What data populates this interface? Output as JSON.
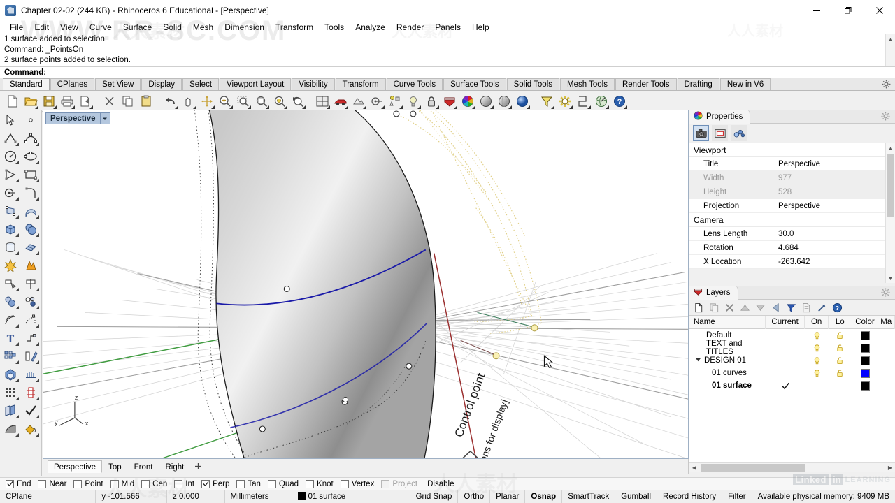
{
  "window": {
    "title": "Chapter 02-02 (244 KB) - Rhinoceros 6 Educational - [Perspective]",
    "icon": "rhino-app-icon",
    "controls": {
      "minimize": "minimize-icon",
      "restore": "restore-icon",
      "close": "close-icon"
    }
  },
  "menubar": {
    "items": [
      {
        "label": "File"
      },
      {
        "label": "Edit"
      },
      {
        "label": "View"
      },
      {
        "label": "Curve"
      },
      {
        "label": "Surface"
      },
      {
        "label": "Solid"
      },
      {
        "label": "Mesh"
      },
      {
        "label": "Dimension"
      },
      {
        "label": "Transform"
      },
      {
        "label": "Tools"
      },
      {
        "label": "Analyze"
      },
      {
        "label": "Render"
      },
      {
        "label": "Panels"
      },
      {
        "label": "Help"
      }
    ]
  },
  "command_history": {
    "lines": [
      "1 surface added to selection.",
      "Command: _PointsOn",
      "2 surface points added to selection."
    ],
    "prompt": "Command:"
  },
  "toolbar_tabs": {
    "active": "Standard",
    "items": [
      "Standard",
      "CPlanes",
      "Set View",
      "Display",
      "Select",
      "Viewport Layout",
      "Visibility",
      "Transform",
      "Curve Tools",
      "Surface Tools",
      "Solid Tools",
      "Mesh Tools",
      "Render Tools",
      "Drafting",
      "New in V6"
    ]
  },
  "main_toolbar": {
    "buttons": [
      "new-file-icon",
      "open-folder-icon",
      "save-icon",
      "print-icon",
      "export-icon",
      "cut-scissors-icon",
      "copy-icon",
      "paste-icon",
      "undo-icon",
      "pan-hand-icon",
      "rotate-view-icon",
      "zoom-in-icon",
      "zoom-window-icon",
      "zoom-extents-icon",
      "zoom-selected-icon",
      "zoom-previous-icon",
      "viewport-layout-icon",
      "four-view-icon",
      "render-car-icon",
      "render-preview-icon",
      "set-cplane-icon",
      "object-snap-icon",
      "light-bulb-icon",
      "lock-icon",
      "layers-icon",
      "color-wheel-icon",
      "shade-sphere-icon",
      "render-sphere-icon",
      "blue-sphere-icon",
      "selection-filter-icon",
      "options-gear-icon",
      "distance-icon",
      "analyze-globe-icon",
      "help-icon"
    ]
  },
  "left_toolbar": {
    "buttons": [
      "select-arrow-icon",
      "point-icon",
      "polyline-icon",
      "control-point-curve-icon",
      "circle-icon",
      "ellipse-icon",
      "polygon-icon",
      "rectangle-icon",
      "arc-icon",
      "curve-fillet-icon",
      "surface-edit-points-icon",
      "surface-from-curve-icon",
      "box-icon",
      "sphere-icon",
      "cylinder-icon",
      "surface-patch-icon",
      "explode-icon",
      "boolean-icon",
      "trim-icon",
      "split-icon",
      "fillet-icon",
      "chamfer-icon",
      "offset-curve-icon",
      "offset-surface-icon",
      "text-icon",
      "dimension-icon",
      "array-icon",
      "mirror-icon",
      "extrude-solid-icon",
      "loft-icon",
      "grid-array-icon",
      "rebuild-icon",
      "copy-object-icon",
      "check-icon",
      "shade-icon",
      "paint-bucket-icon"
    ]
  },
  "viewport": {
    "title": "Perspective",
    "dropdown_icon": "chevron-down-icon",
    "cplane_axes": {
      "x": "x",
      "y": "y",
      "z": "z"
    },
    "annotations": [
      {
        "text": "Control point"
      },
      {
        "text": "[options for display]"
      }
    ],
    "colors": {
      "grid_line": "#cfcfcf",
      "grid_major": "#9a9a9a",
      "x_axis": "#8f3030",
      "y_axis": "#2f7a2f",
      "surface_light": "#f2f2f2",
      "surface_dark": "#8e8e8e",
      "isocurve": "#1a1aaa",
      "control_polygon": "#e3cf8a",
      "control_point": "#f0e8a8"
    },
    "tabs": {
      "active": "Perspective",
      "items": [
        "Perspective",
        "Top",
        "Front",
        "Right"
      ],
      "add_label": "+"
    }
  },
  "properties_panel": {
    "title": "Properties",
    "icon": "properties-icon",
    "gear_icon": "gear-icon",
    "tool_icons": [
      {
        "name": "camera-icon",
        "selected": true
      },
      {
        "name": "viewport-frame-icon",
        "selected": false
      },
      {
        "name": "material-icon",
        "selected": false
      }
    ],
    "groups": [
      {
        "title": "Viewport",
        "rows": [
          {
            "key": "Title",
            "value": "Perspective",
            "dim": false,
            "dropdown": false
          },
          {
            "key": "Width",
            "value": "977",
            "dim": true,
            "dropdown": false
          },
          {
            "key": "Height",
            "value": "528",
            "dim": true,
            "dropdown": false
          },
          {
            "key": "Projection",
            "value": "Perspective",
            "dim": false,
            "dropdown": true
          }
        ]
      },
      {
        "title": "Camera",
        "rows": [
          {
            "key": "Lens Length",
            "value": "30.0",
            "dim": false,
            "dropdown": false
          },
          {
            "key": "Rotation",
            "value": "4.684",
            "dim": false,
            "dropdown": false
          },
          {
            "key": "X Location",
            "value": "-263.642",
            "dim": false,
            "dropdown": false
          }
        ]
      }
    ]
  },
  "layers_panel": {
    "title": "Layers",
    "icon": "layers-icon",
    "gear_icon": "gear-icon",
    "toolbar_icons": [
      "new-layer-icon",
      "copy-layer-icon",
      "delete-layer-icon",
      "move-up-icon",
      "move-down-icon",
      "move-left-icon",
      "filter-icon",
      "layer-properties-icon",
      "layer-tools-icon",
      "help-icon"
    ],
    "columns": [
      "Name",
      "Current",
      "On",
      "Lo",
      "Color",
      "Ma"
    ],
    "rows": [
      {
        "name": "Default",
        "indent": 1,
        "current": false,
        "on": true,
        "lock": "unlocked",
        "color": "#000000",
        "bold": false,
        "expander": ""
      },
      {
        "name": "TEXT and TITLES",
        "indent": 1,
        "current": false,
        "on": true,
        "lock": "unlocked",
        "color": "#000000",
        "bold": false,
        "expander": ""
      },
      {
        "name": "DESIGN 01",
        "indent": 0,
        "current": false,
        "on": true,
        "lock": "unlocked",
        "color": "#000000",
        "bold": false,
        "expander": "expanded"
      },
      {
        "name": "01 curves",
        "indent": 2,
        "current": false,
        "on": true,
        "lock": "unlocked",
        "color": "#0000ff",
        "bold": false,
        "expander": ""
      },
      {
        "name": "01 surface",
        "indent": 2,
        "current": true,
        "on": false,
        "lock": "none",
        "color": "#000000",
        "bold": true,
        "expander": ""
      }
    ]
  },
  "osnap_bar": {
    "items": [
      {
        "label": "End",
        "checked": true,
        "enabled": true
      },
      {
        "label": "Near",
        "checked": false,
        "enabled": true
      },
      {
        "label": "Point",
        "checked": false,
        "enabled": true
      },
      {
        "label": "Mid",
        "checked": false,
        "enabled": true
      },
      {
        "label": "Cen",
        "checked": false,
        "enabled": true
      },
      {
        "label": "Int",
        "checked": false,
        "enabled": true
      },
      {
        "label": "Perp",
        "checked": true,
        "enabled": true
      },
      {
        "label": "Tan",
        "checked": false,
        "enabled": true
      },
      {
        "label": "Quad",
        "checked": false,
        "enabled": true
      },
      {
        "label": "Knot",
        "checked": false,
        "enabled": true
      },
      {
        "label": "Vertex",
        "checked": false,
        "enabled": true
      },
      {
        "label": "Project",
        "checked": false,
        "enabled": false
      }
    ],
    "disable_label": "Disable"
  },
  "status_bar": {
    "cplane": "CPlane",
    "x": "",
    "y": "y -101.566",
    "z": "z 0.000",
    "units": "Millimeters",
    "layer": "01 surface",
    "layer_color": "#000000",
    "toggles": [
      {
        "label": "Grid Snap",
        "active": false
      },
      {
        "label": "Ortho",
        "active": false
      },
      {
        "label": "Planar",
        "active": false
      },
      {
        "label": "Osnap",
        "active": true
      },
      {
        "label": "SmartTrack",
        "active": false
      },
      {
        "label": "Gumball",
        "active": false
      },
      {
        "label": "Record History",
        "active": false
      },
      {
        "label": "Filter",
        "active": false
      }
    ],
    "memory": "Available physical memory: 9409 MB"
  },
  "watermarks": {
    "site": "WWW.RR-SC.COM",
    "cn": "人人素材",
    "brand_linkedin": "Linked",
    "brand_in": "in",
    "brand_learning": "LEARNING"
  }
}
